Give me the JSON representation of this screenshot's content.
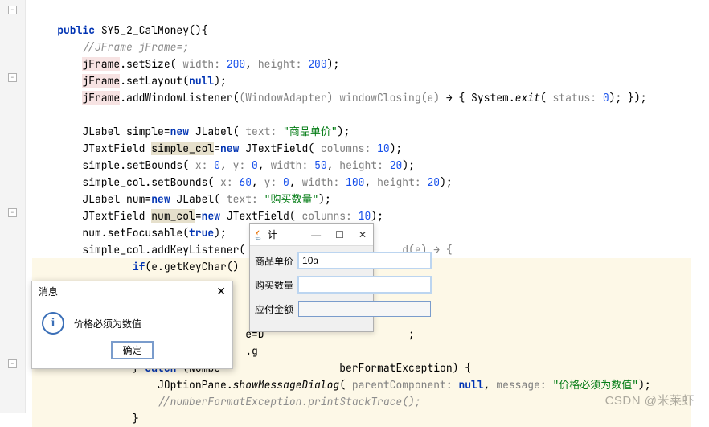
{
  "code": {
    "l1a": "public",
    "l1b": " SY5_2_CalMoney(){",
    "l2": "//JFrame jFrame=;",
    "l3a": "jFrame",
    "l3b": ".setSize(",
    "l3c": " width: ",
    "l3d": "200",
    "l3e": ", ",
    "l3f": "height: ",
    "l3g": "200",
    "l3h": ");",
    "l4a": "jFrame",
    "l4b": ".setLayout(",
    "l4c": "null",
    "l4d": ");",
    "l5a": "jFrame",
    "l5b": ".addWindowListener(",
    "l5c": "(WindowAdapter) ",
    "l5d": "windowClosing(e)",
    "l5e": " → { System.",
    "l5f": "exit",
    "l5g": "(",
    "l5h": " status: ",
    "l5i": "0",
    "l5j": "); });",
    "l6a": "JLabel simple=",
    "l6b": "new",
    "l6c": " JLabel(",
    "l6d": " text: ",
    "l6e": "\"商品单价\"",
    "l6f": ");",
    "l7a": "JTextField ",
    "l7b": "simple_col",
    "l7c": "=",
    "l7d": "new",
    "l7e": " JTextField(",
    "l7f": " columns: ",
    "l7g": "10",
    "l7h": ");",
    "l8a": "simple.setBounds(",
    "l8b": " x: ",
    "l8c": "0",
    "l8d": ", ",
    "l8e": "y: ",
    "l8f": "0",
    "l8g": ", ",
    "l8h": "width: ",
    "l8i": "50",
    "l8j": ", ",
    "l8k": "height: ",
    "l8l": "20",
    "l8m": ");",
    "l9a": "simple_col.setBounds(",
    "l9b": " x: ",
    "l9c": "60",
    "l9d": ", ",
    "l9e": "y: ",
    "l9f": "0",
    "l9g": ", ",
    "l9h": "width: ",
    "l9i": "100",
    "l9j": ", ",
    "l9k": "height: ",
    "l9l": "20",
    "l9m": ");",
    "l10a": "JLabel num=",
    "l10b": "new",
    "l10c": " JLabel(",
    "l10d": " text: ",
    "l10e": "\"购买数量\"",
    "l10f": ");",
    "l11a": "JTextField ",
    "l11b": "num_col",
    "l11c": "=",
    "l11d": "new",
    "l11e": " JTextField(",
    "l11f": " columns: ",
    "l11g": "10",
    "l11h": ");",
    "l12a": "num.setFocusable(",
    "l12b": "true",
    "l12c": ");",
    "l13a": "simple_col.addKeyListener(",
    "l13b": "d(e) → {",
    "l14a": "if",
    "l14b": "(e.getKeyChar()",
    "l15a": "e=D",
    "l15b": ";",
    "l16a": ".g",
    "l17a": "} ",
    "l17b": "catch",
    "l17c": " (Numbe",
    "l17d": "berFormatException) {",
    "l18a": "JOptionPane.",
    "l18b": "showMessageDialog",
    "l18c": "(",
    "l18d": " parentComponent: ",
    "l18e": "null",
    "l18f": ", ",
    "l18g": "message: ",
    "l18h": "\"价格必须为数值\"",
    "l18i": ");",
    "l19": "//numberFormatException.printStackTrace();",
    "l20": "}"
  },
  "window": {
    "title": "计",
    "row1_label": "商品单价",
    "row1_value": "10a",
    "row2_label": "购买数量",
    "row2_value": "",
    "row3_label": "应付金额",
    "row3_value": ""
  },
  "dialog": {
    "title": "消息",
    "message": "价格必须为数值",
    "ok": "确定"
  },
  "watermark": "CSDN @米莱虾"
}
